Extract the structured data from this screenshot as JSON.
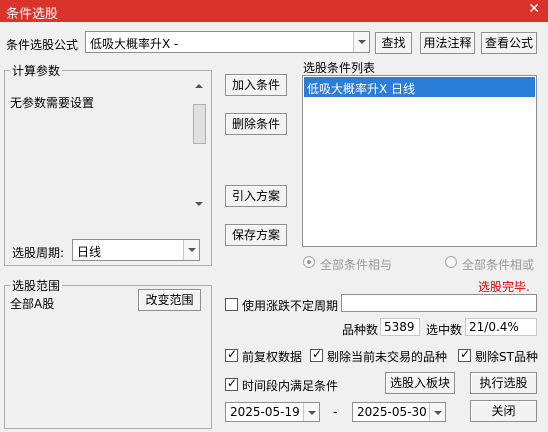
{
  "window": {
    "title": "条件选股",
    "close": "✕"
  },
  "formula": {
    "label": "条件选股公式",
    "value": "低吸大概率升X -",
    "find_button": "查找",
    "usage_button": "用法注释",
    "view_button": "查看公式"
  },
  "params": {
    "group_title": "计算参数",
    "no_params": "无参数需要设置",
    "period_label": "选股周期:",
    "period_value": "日线"
  },
  "actions": {
    "add": "加入条件",
    "delete": "删除条件",
    "import": "引入方案",
    "save": "保存方案"
  },
  "conditions": {
    "title": "选股条件列表",
    "items": [
      "低吸大概率升X  日线"
    ],
    "radio_and": "全部条件相与",
    "radio_or": "全部条件相或"
  },
  "status": {
    "text": "选股完毕."
  },
  "range": {
    "group_title": "选股范围",
    "value": "全部A股",
    "change_button": "改变范围"
  },
  "options": {
    "variable_period": "使用涨跌不定周期",
    "variable_period_value": "",
    "count_label": "品种数",
    "count_value": "5389",
    "selected_label": "选中数",
    "selected_value": "21/0.4%",
    "adjust": "前复权数据",
    "exclude_untraded": "剔除当前未交易的品种",
    "exclude_st": "剔除ST品种",
    "time_range": "时间段内满足条件"
  },
  "dates": {
    "start": "2025-05-19",
    "separator": "-",
    "end": "2025-05-30"
  },
  "buttons": {
    "to_block": "选股入板块",
    "execute": "执行选股",
    "close": "关闭"
  }
}
